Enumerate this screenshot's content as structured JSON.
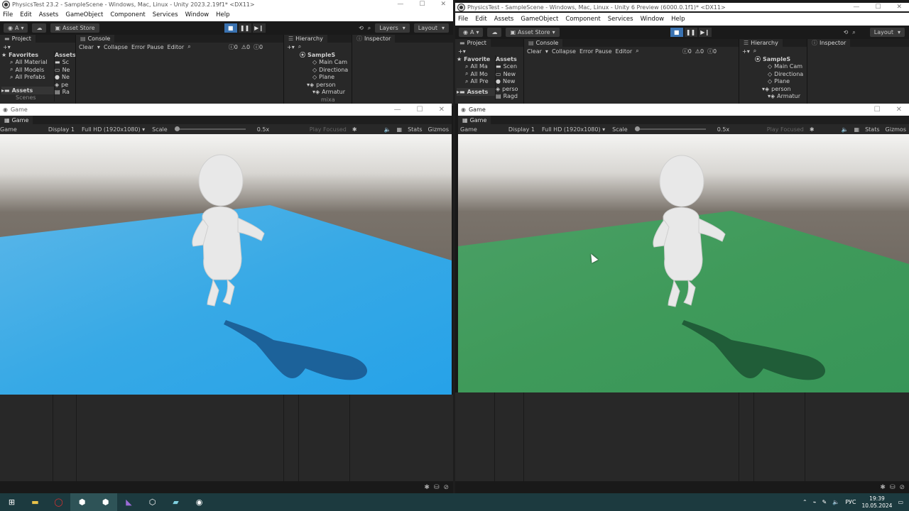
{
  "left": {
    "title": "PhysicsTest 23.2 - SampleScene - Windows, Mac, Linux - Unity 2023.2.19f1* <DX11>",
    "menu": [
      "File",
      "Edit",
      "Assets",
      "GameObject",
      "Component",
      "Services",
      "Window",
      "Help"
    ],
    "toolbar": {
      "account": "A",
      "asset_store": "Asset Store",
      "layers": "Layers",
      "layout": "Layout"
    },
    "project_tab": "Project",
    "console_tab": "Console",
    "hierarchy_tab": "Hierarchy",
    "inspector_tab": "Inspector",
    "console_bar": {
      "clear": "Clear",
      "collapse": "Collapse",
      "error_pause": "Error Pause",
      "editor": "Editor",
      "c1": "0",
      "c2": "0",
      "c3": "0"
    },
    "favorites_header": "Favorites",
    "favorites": [
      "All Material",
      "All Models",
      "All Prefabs"
    ],
    "assets_header": "Assets",
    "assets_tree": [
      "Scenes"
    ],
    "assets_col_header": "Assets",
    "assets_col": [
      "Sc",
      "Ne",
      "Ne",
      "pe",
      "Ra"
    ],
    "hierarchy": [
      "SampleS",
      "Main Cam",
      "Directiona",
      "Plane",
      "person",
      "Armatur",
      "mixa"
    ],
    "game": {
      "window_title": "Game",
      "tab": "Game",
      "view": "Game",
      "display": "Display 1",
      "resolution": "Full HD (1920x1080)",
      "scale_label": "Scale",
      "scale_value": "0.5x",
      "play_focused": "Play Focused",
      "stats": "Stats",
      "gizmos": "Gizmos"
    }
  },
  "right": {
    "title": "PhysicsTest - SampleScene - Windows, Mac, Linux - Unity 6 Preview (6000.0.1f1)* <DX11>",
    "menu": [
      "File",
      "Edit",
      "Assets",
      "GameObject",
      "Component",
      "Services",
      "Window",
      "Help"
    ],
    "toolbar": {
      "account": "A",
      "asset_store": "Asset Store",
      "layout": "Layout"
    },
    "project_tab": "Project",
    "console_tab": "Console",
    "hierarchy_tab": "Hierarchy",
    "inspector_tab": "Inspector",
    "console_bar": {
      "clear": "Clear",
      "collapse": "Collapse",
      "error_pause": "Error Pause",
      "editor": "Editor",
      "c1": "0",
      "c2": "0",
      "c3": "0"
    },
    "favorites_header": "Favorite",
    "favorites": [
      "All Ma",
      "All Mo",
      "All Pre"
    ],
    "assets_header": "Assets",
    "assets_col_header": "Assets",
    "assets_col": [
      "Scen",
      "New",
      "New",
      "perso",
      "Ragd"
    ],
    "hierarchy": [
      "SampleS",
      "Main Cam",
      "Directiona",
      "Plane",
      "person",
      "Armatur"
    ],
    "game": {
      "window_title": "Game",
      "tab": "Game",
      "view": "Game",
      "display": "Display 1",
      "resolution": "Full HD (1920x1080)",
      "scale_label": "Scale",
      "scale_value": "0.5x",
      "play_focused": "Play Focused",
      "stats": "Stats",
      "gizmos": "Gizmos"
    }
  },
  "taskbar": {
    "lang": "РУС",
    "time": "19:39",
    "date": "10.05.2024"
  },
  "colors": {
    "left_floor": "#3aa6e0",
    "right_floor": "#3f9a5a",
    "sky": "#f2f2f0",
    "horizon": "#625a52"
  }
}
